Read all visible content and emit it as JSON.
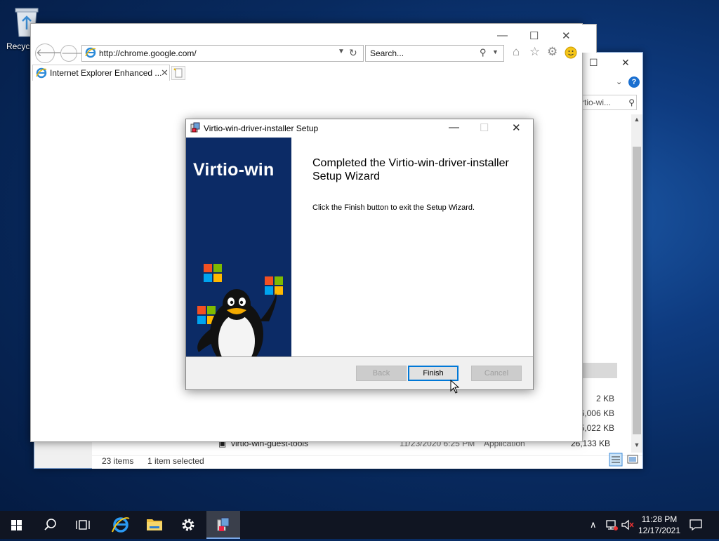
{
  "desktop": {
    "recycle_label": "Recycl"
  },
  "explorer": {
    "search_placeholder": "rtio-wi...",
    "sizes": [
      "2 KB",
      "6,006 KB",
      "5,022 KB",
      "26,133 KB"
    ],
    "row": {
      "name": "virtio-win-guest-tools",
      "date": "11/23/2020 6:25 PM",
      "type": "Application",
      "size": "26,133 KB"
    },
    "status_count": "23 items",
    "status_selected": "1 item selected"
  },
  "ie": {
    "url": "http://chrome.google.com/",
    "search_placeholder": "Search...",
    "tab_title": "Internet Explorer Enhanced ..."
  },
  "dialog": {
    "title": "Virtio-win-driver-installer Setup",
    "brand": "Virtio-win",
    "heading": "Completed the Virtio-win-driver-installer Setup Wizard",
    "message": "Click the Finish button to exit the Setup Wizard.",
    "back_label": "Back",
    "finish_label": "Finish",
    "cancel_label": "Cancel"
  },
  "taskbar": {
    "time": "11:28 PM",
    "date": "12/17/2021"
  },
  "colors": {
    "accent": "#0078d7",
    "banner": "#0c2b66",
    "taskbar": "#101522"
  }
}
